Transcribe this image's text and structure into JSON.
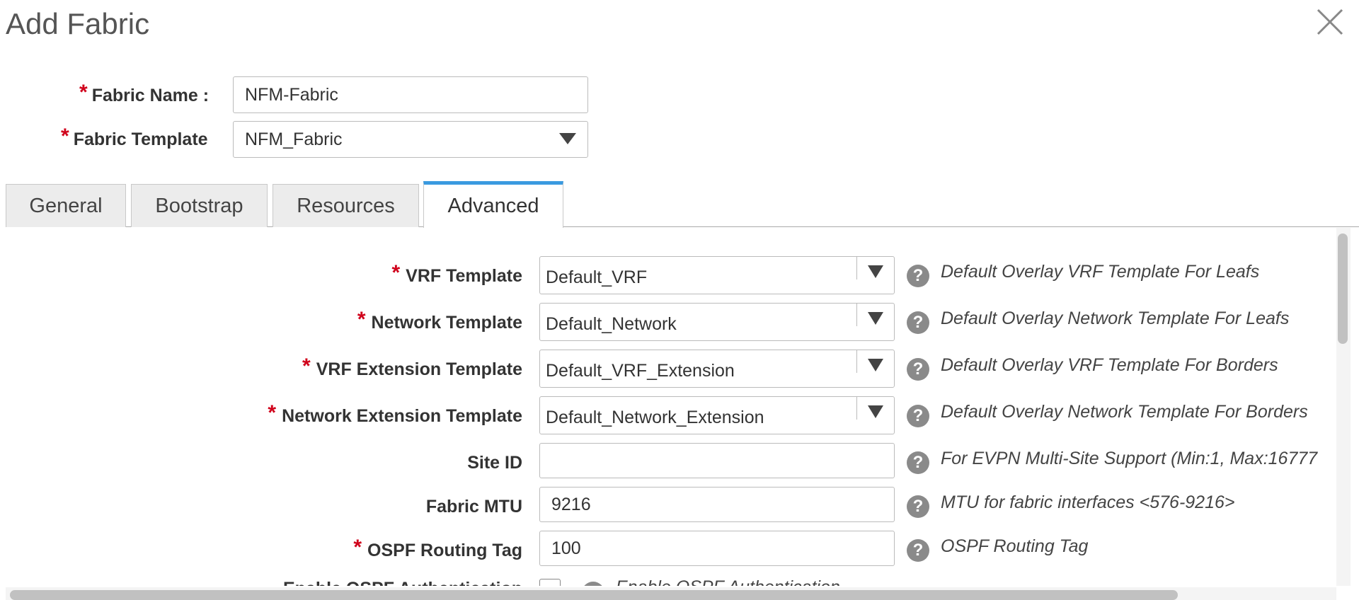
{
  "dialog": {
    "title": "Add Fabric",
    "close_icon": "close-icon"
  },
  "fabric_name": {
    "label": "Fabric Name :",
    "value": "NFM-Fabric"
  },
  "fabric_template": {
    "label": "Fabric Template",
    "value": "NFM_Fabric"
  },
  "tabs": [
    {
      "label": "General"
    },
    {
      "label": "Bootstrap"
    },
    {
      "label": "Resources"
    },
    {
      "label": "Advanced",
      "active": true
    }
  ],
  "advanced": {
    "rows": [
      {
        "label": "VRF Template",
        "required": true,
        "type": "select",
        "value": "Default_VRF",
        "help": "Default Overlay VRF Template For Leafs"
      },
      {
        "label": "Network Template",
        "required": true,
        "type": "select",
        "value": "Default_Network",
        "help": "Default Overlay Network Template For Leafs"
      },
      {
        "label": "VRF Extension Template",
        "required": true,
        "type": "select",
        "value": "Default_VRF_Extension",
        "help": "Default Overlay VRF Template For Borders"
      },
      {
        "label": "Network Extension Template",
        "required": true,
        "type": "select",
        "value": "Default_Network_Extension",
        "help": "Default Overlay Network Template For Borders"
      },
      {
        "label": "Site ID",
        "required": false,
        "type": "text",
        "value": "",
        "help": "For EVPN Multi-Site Support (Min:1, Max:16777"
      },
      {
        "label": "Fabric MTU",
        "required": false,
        "type": "text",
        "value": "9216",
        "help": "MTU for fabric interfaces <576-9216>"
      },
      {
        "label": "OSPF Routing Tag",
        "required": true,
        "type": "text",
        "value": "100",
        "help": "OSPF Routing Tag"
      },
      {
        "label": "Enable OSPF Authentication",
        "required": false,
        "type": "checkbox",
        "checked": false,
        "help": "Enable OSPF Authentication"
      }
    ]
  },
  "colors": {
    "required": "#d0021b",
    "active_tab": "#3a9ae0",
    "help_icon": "#8a8a8a"
  }
}
